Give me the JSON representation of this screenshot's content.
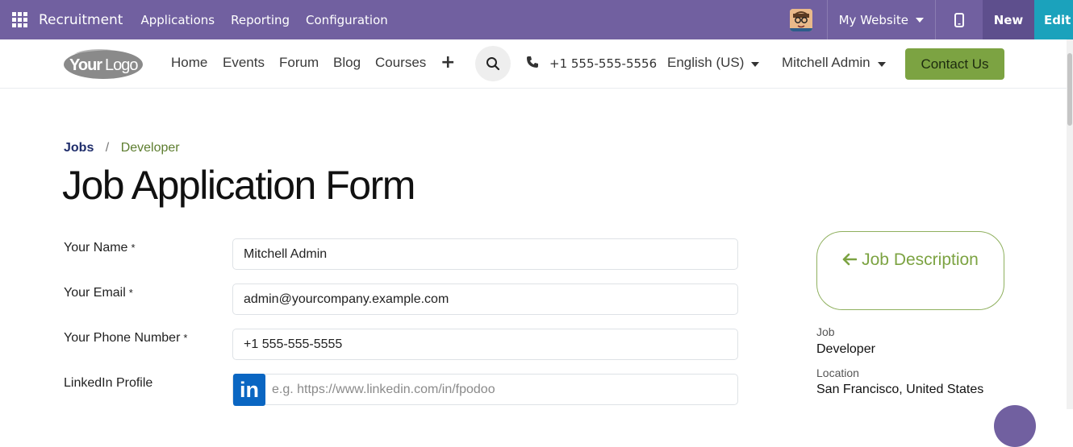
{
  "topbar": {
    "app_name": "Recruitment",
    "menu": [
      "Applications",
      "Reporting",
      "Configuration"
    ],
    "website_selector": "My Website",
    "new_label": "New",
    "edit_label": "Edit",
    "bg_color": "#7160a0"
  },
  "site_header": {
    "logo_text": "YourLogo",
    "nav": [
      "Home",
      "Events",
      "Forum",
      "Blog",
      "Courses"
    ],
    "phone": "+1 555-555-5556",
    "language": "English (US)",
    "user": "Mitchell Admin",
    "contact_label": "Contact Us",
    "accent_color": "#7ca342"
  },
  "breadcrumb": {
    "root": "Jobs",
    "current": "Developer"
  },
  "page_title": "Job Application Form",
  "form": {
    "name_label": "Your Name",
    "name_value": "Mitchell Admin",
    "email_label": "Your Email",
    "email_value": "admin@yourcompany.example.com",
    "phone_label": "Your Phone Number",
    "phone_value": "+1 555-555-5555",
    "linkedin_label": "LinkedIn Profile",
    "linkedin_placeholder": "e.g. https://www.linkedin.com/in/fpodoo",
    "linkedin_icon_text": "in",
    "required_marker": "*"
  },
  "sidebar": {
    "job_description_button": "Job Description",
    "job_label": "Job",
    "job_value": "Developer",
    "location_label": "Location",
    "location_value": "San Francisco, United States"
  }
}
